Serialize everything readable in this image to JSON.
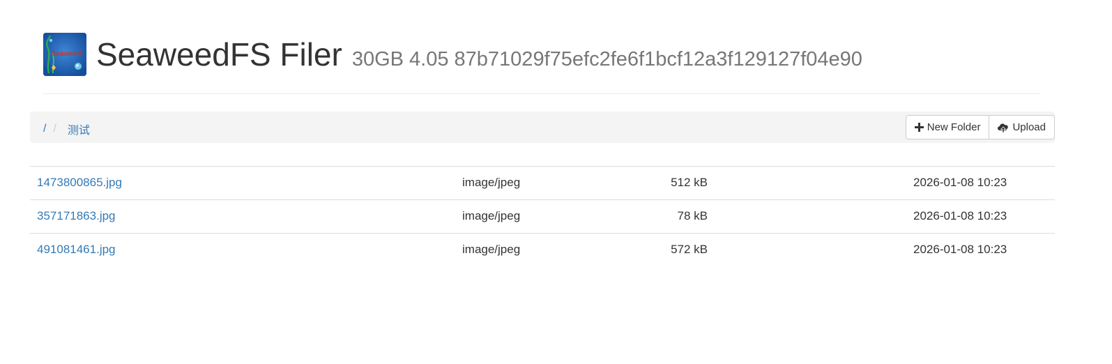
{
  "header": {
    "logo_text": "Seaweed",
    "title": "SeaweedFS Filer",
    "subtitle": "30GB 4.05 87b71029f75efc2fe6f1bcf12a3f129127f04e90"
  },
  "breadcrumb": {
    "root": "/",
    "separator": "/",
    "items": [
      "测试"
    ]
  },
  "toolbar": {
    "new_folder_label": "New Folder",
    "upload_label": "Upload",
    "new_folder_icon": "plus-icon",
    "upload_icon": "cloud-upload-icon"
  },
  "files": [
    {
      "name": "1473800865.jpg",
      "mime": "image/jpeg",
      "size": "512 kB",
      "modified": "2026-01-08 10:23"
    },
    {
      "name": "357171863.jpg",
      "mime": "image/jpeg",
      "size": "78 kB",
      "modified": "2026-01-08 10:23"
    },
    {
      "name": "491081461.jpg",
      "mime": "image/jpeg",
      "size": "572 kB",
      "modified": "2026-01-08 10:23"
    }
  ],
  "colors": {
    "link": "#337ab7",
    "breadcrumb_bg": "#f4f4f4",
    "logo_bg": "#1b5fb0"
  }
}
